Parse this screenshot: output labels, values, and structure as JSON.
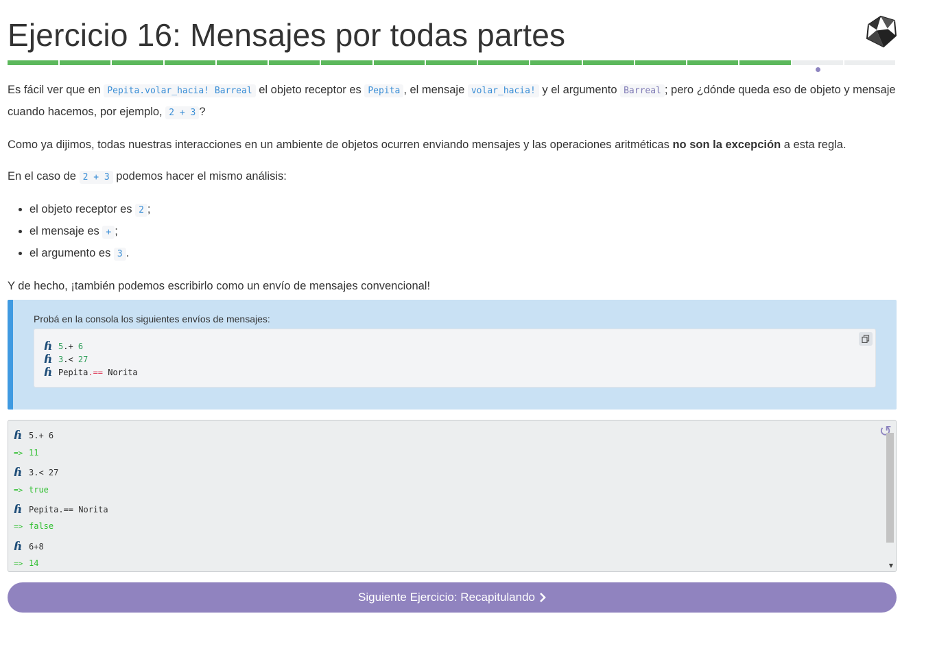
{
  "header": {
    "title": "Ejercicio 16: Mensajes por todas partes",
    "logo_icon": "ruby-gem-icon"
  },
  "progress": {
    "total_segments": 17,
    "completed_segments": 15,
    "current_segment": 16,
    "completed_color": "#5cb85c",
    "todo_color": "#eceeef",
    "current_marker_color": "#8e85c0"
  },
  "content": {
    "p1": {
      "t1": "Es fácil ver que en ",
      "c1": "Pepita.volar_hacia! Barreal",
      "t2": " el objeto receptor es ",
      "c2": "Pepita",
      "t3": ", el mensaje ",
      "c3": "volar_hacia!",
      "t4": " y el argumento ",
      "c4": "Barreal",
      "t5": "; pero ¿dónde queda eso de objeto y mensaje cuando hacemos, por ejemplo, ",
      "c5": "2 + 3",
      "t6": "?"
    },
    "p2": {
      "t1": "Como ya dijimos, todas nuestras interacciones en un ambiente de objetos ocurren enviando mensajes y las operaciones aritméticas ",
      "bold": "no son la excepción",
      "t2": " a esta regla."
    },
    "p3": {
      "t1": "En el caso de ",
      "c1": "2 + 3",
      "t2": " podemos hacer el mismo análisis:"
    },
    "list": [
      {
        "t1": "el objeto receptor es ",
        "code": "2",
        "t2": ";"
      },
      {
        "t1": "el mensaje es ",
        "code": "+",
        "t2": ";"
      },
      {
        "t1": "el argumento es ",
        "code": "3",
        "t2": "."
      }
    ],
    "p4": "Y de hecho, ¡también podemos escribirlo como un envío de mensajes convencional!"
  },
  "callout": {
    "text": "Probá en la consola los siguientes envíos de mensajes:",
    "copy_icon": "copy-icon",
    "prompt_glyph": "ɦ",
    "lines": [
      {
        "a": "5",
        "op": ".+ ",
        "b": "6"
      },
      {
        "a": "3",
        "op": ".< ",
        "b": "27"
      },
      {
        "a": "Pepita",
        "op": ".== ",
        "b": "Norita"
      }
    ]
  },
  "console": {
    "prompt_glyph": "ɦ",
    "result_arrow": "=>",
    "reset_icon": "reset-icon",
    "entries": [
      {
        "input": "5.+ 6",
        "output": "11"
      },
      {
        "input": "3.< 27",
        "output": "true"
      },
      {
        "input": "Pepita.== Norita",
        "output": "false"
      },
      {
        "input": "6+8",
        "output": "14"
      }
    ]
  },
  "next_button": {
    "label": "Siguiente Ejercicio: Recapitulando",
    "icon": "chevron-right-icon",
    "color": "#9083bf"
  }
}
